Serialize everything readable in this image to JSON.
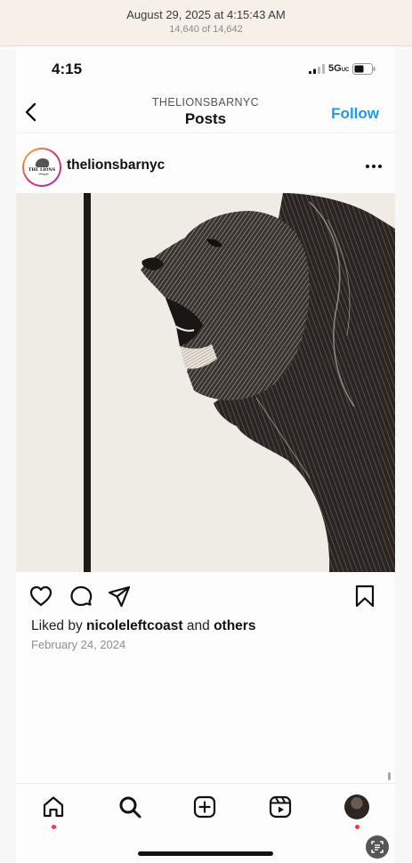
{
  "photos": {
    "date": "August 29, 2025 at 4:15:43 AM",
    "count": "14,640 of 14,642"
  },
  "status_bar": {
    "time": "4:15",
    "network": "5G",
    "network_suffix": "UC"
  },
  "nav": {
    "account": "THELIONSBARNYC",
    "title": "Posts",
    "follow_label": "Follow"
  },
  "post": {
    "username": "thelionsbarnyc",
    "avatar_text": "THE LIONS",
    "liked_prefix": "Liked by",
    "liked_user": "nicoleleftcoast",
    "liked_and": "and",
    "liked_others": "others",
    "date": "February 24, 2024"
  },
  "icons": {
    "back": "chevron-left-icon",
    "more": "more-horizontal-icon",
    "heart": "heart-icon",
    "comment": "comment-icon",
    "share": "send-icon",
    "bookmark": "bookmark-icon",
    "home": "home-icon",
    "search": "search-icon",
    "create": "plus-square-icon",
    "reels": "reels-icon",
    "profile": "profile-avatar-icon"
  },
  "colors": {
    "accent": "#1a9bf0",
    "notification": "#ff3040",
    "photos_bar": "#f6f0e8"
  }
}
